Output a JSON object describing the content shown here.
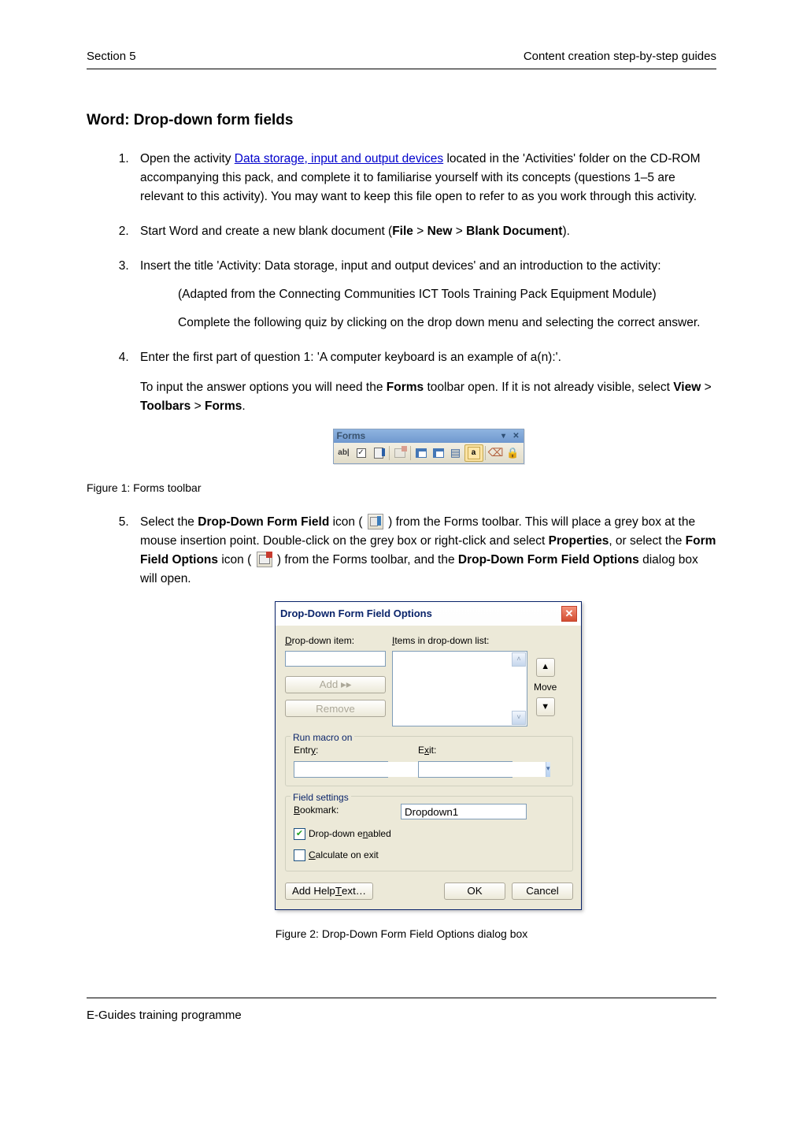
{
  "header": {
    "left": "Section 5",
    "right": "Content creation step-by-step guides"
  },
  "title": "Word: Drop-down form fields",
  "steps": {
    "s1": {
      "pre": "Open the activity ",
      "link": "Data storage, input and output devices",
      "post": " located in the 'Activities' folder on the CD-ROM accompanying this pack, and complete it to familiarise yourself with its concepts (questions 1–5 are relevant to this activity). You may want to keep this file open to refer to as you work through this activity."
    },
    "s2": {
      "a": "Start Word and create a new blank document (",
      "b1": "File",
      "gt1": " > ",
      "b2": "New",
      "gt2": " > ",
      "b3": "Blank Document",
      "end": ")."
    },
    "s3": {
      "a": "Insert the title 'Activity: Data storage, input and output devices' and an introduction to the activity:",
      "quote1": "(Adapted from the Connecting Communities ICT Tools Training Pack Equipment Module)",
      "quote2": "Complete the following quiz by clicking on the drop down menu and selecting the correct answer."
    },
    "s4": {
      "a": "Enter the first part of question 1: 'A computer keyboard is an example of a(n):'.",
      "b_pre": "To input the answer options you will need the ",
      "b_forms": "Forms",
      "b_mid": " toolbar open. If it is not already visible, select ",
      "v1": "View",
      "gt1": " > ",
      "v2": "Toolbars",
      "gt2": " > ",
      "v3": "Forms",
      "end": "."
    },
    "s5": {
      "a1": "Select the ",
      "a_b1": "Drop-Down Form Field",
      "a2": " icon ( ",
      "a3": " ) from the Forms toolbar. This will place a grey box at the mouse insertion point. Double-click on the grey box or right-click and select ",
      "a_b2": "Properties",
      "a4": ", or select the ",
      "a_b3": "Form Field Options",
      "a5": " icon ( ",
      "a6": " ) from the Forms toolbar, and the ",
      "a_b4": "Drop-Down Form Field Options",
      "a7": " dialog box will open."
    }
  },
  "forms_toolbar": {
    "title": "Forms",
    "btn_abl": "ab|"
  },
  "fig1": "Figure 1: Forms toolbar",
  "dialog": {
    "title": "Drop-Down Form Field Options",
    "drop_item_label_pre": "D",
    "drop_item_label": "rop-down item:",
    "items_label_pre": "I",
    "items_label": "tems in drop-down list:",
    "add_label": "Add ▸▸",
    "remove_label": "Remove",
    "move_label": "Move",
    "run_macro": "Run macro on",
    "entry_pre": "Entr",
    "entry_u": "y",
    "entry_post": ":",
    "exit_pre": "E",
    "exit_u": "x",
    "exit_post": "it:",
    "field_settings": "Field settings",
    "bookmark_pre": "B",
    "bookmark_label": "ookmark:",
    "bookmark_value": "Dropdown1",
    "enabled_pre": "Drop-down e",
    "enabled_u": "n",
    "enabled_post": "abled",
    "calc_pre": "C",
    "calc_label": "alculate on exit",
    "help_btn_pre": "Add Help ",
    "help_btn_u": "T",
    "help_btn_post": "ext…",
    "ok": "OK",
    "cancel": "Cancel"
  },
  "fig2": "Figure 2: Drop-Down Form Field Options dialog box",
  "footer": "E-Guides training programme"
}
